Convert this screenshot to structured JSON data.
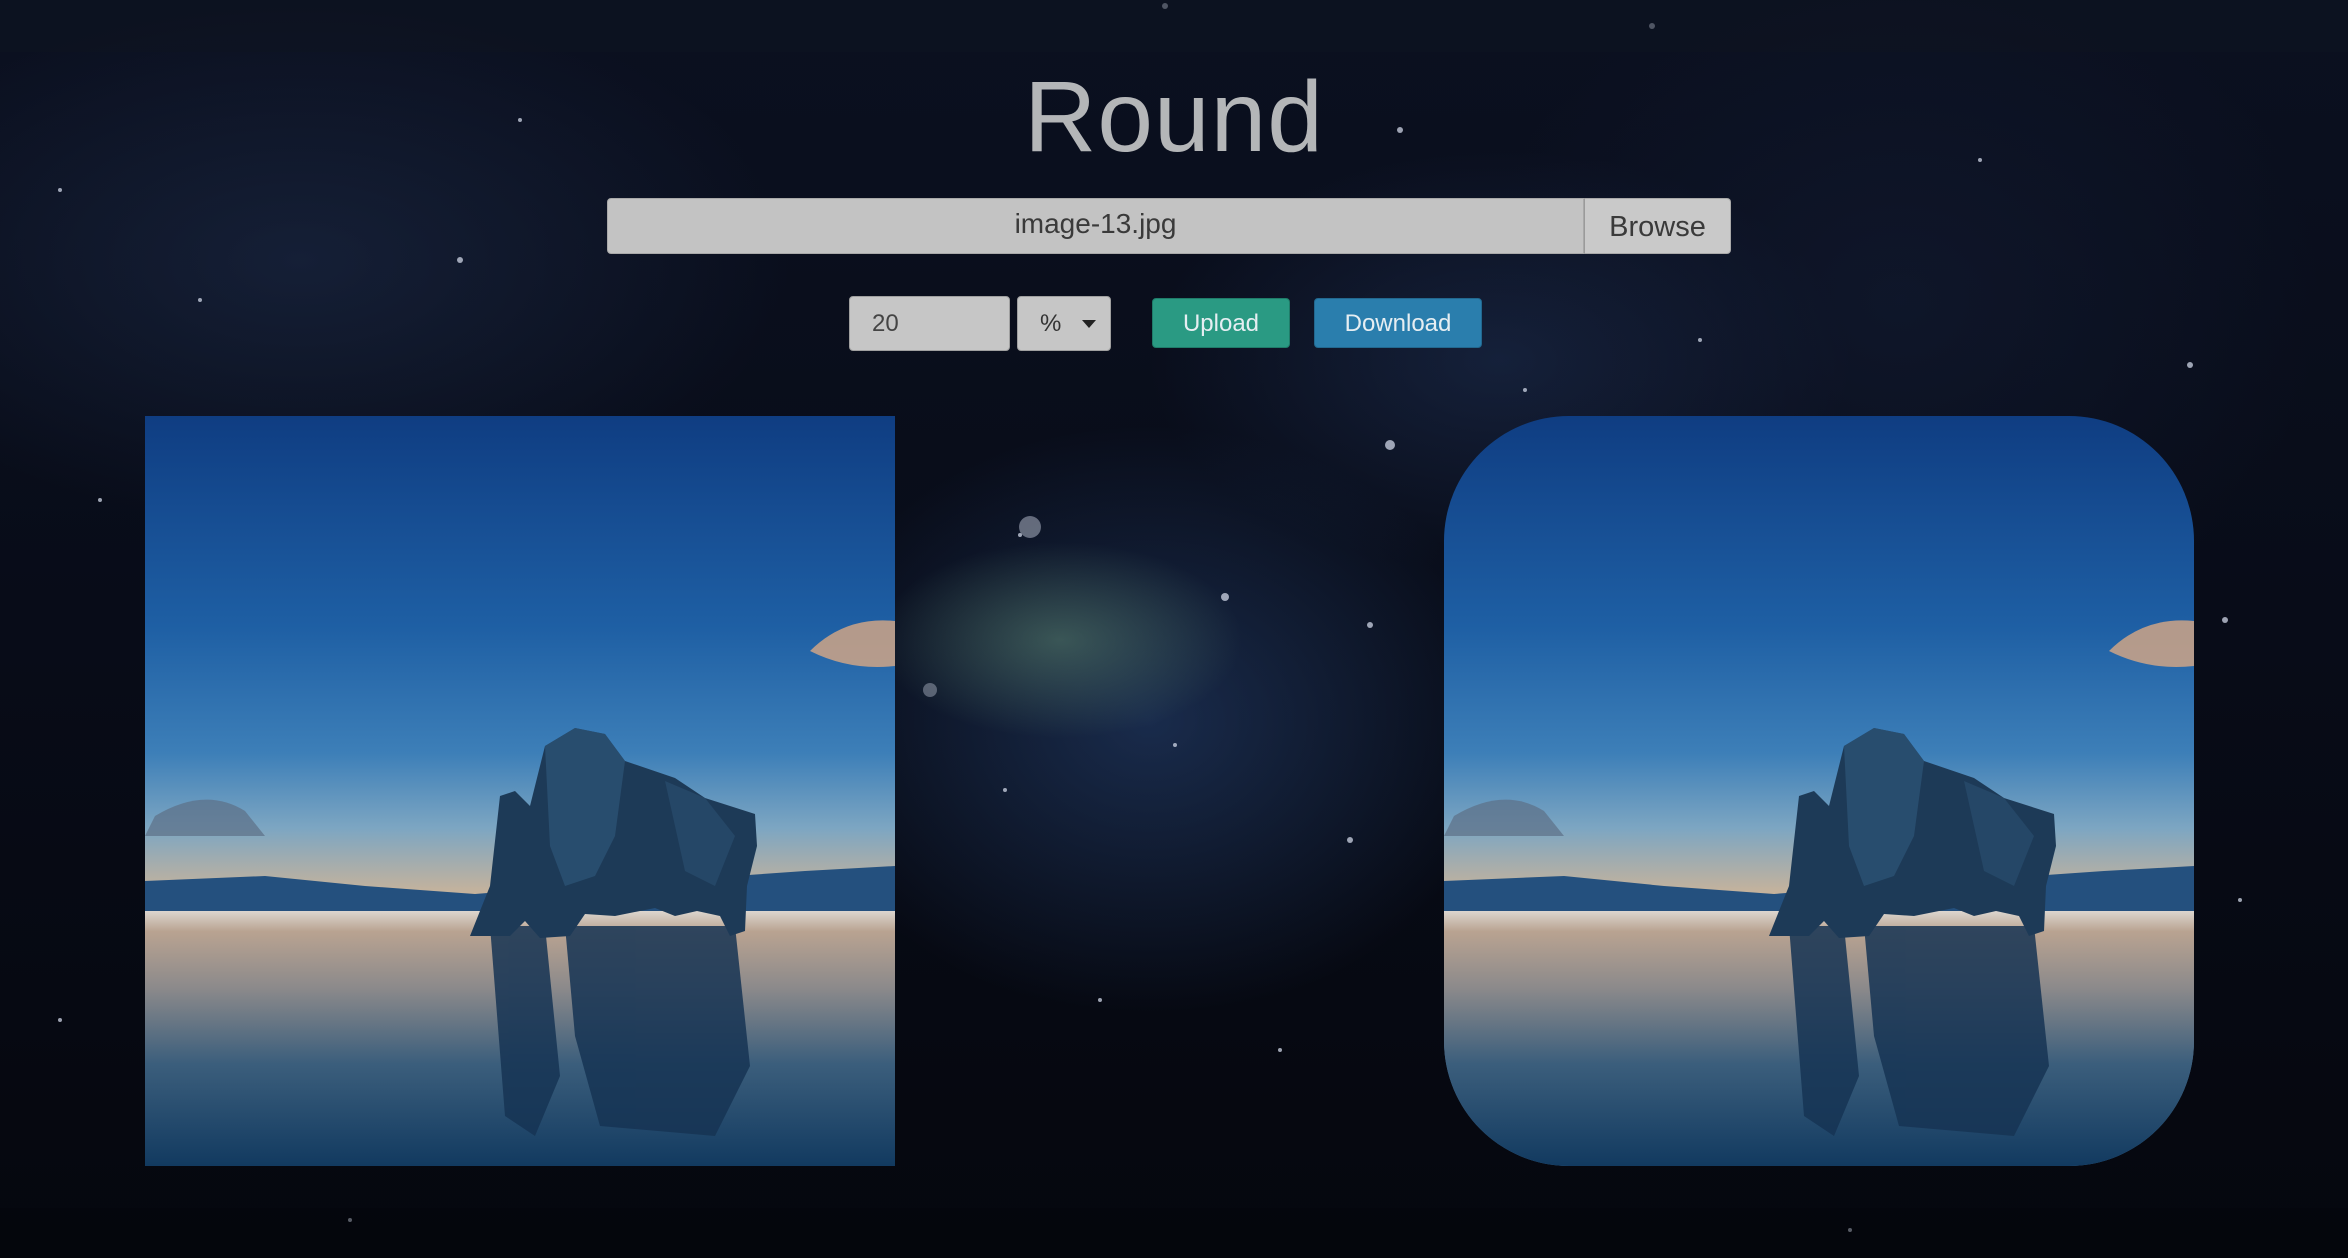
{
  "app": {
    "title": "Round"
  },
  "file_picker": {
    "file_name": "image-13.jpg",
    "browse_label": "Browse"
  },
  "controls": {
    "radius_value": "20",
    "unit_selected": "%",
    "upload_label": "Upload",
    "download_label": "Download"
  },
  "preview": {
    "original_alt": "original image",
    "rounded_alt": "rounded image",
    "corner_radius_percent": 20
  },
  "colors": {
    "upload_button": "#2a9a83",
    "download_button": "#2a7ead",
    "title_text": "#b4b6b8"
  },
  "icons": {
    "select_caret": "caret-down"
  }
}
